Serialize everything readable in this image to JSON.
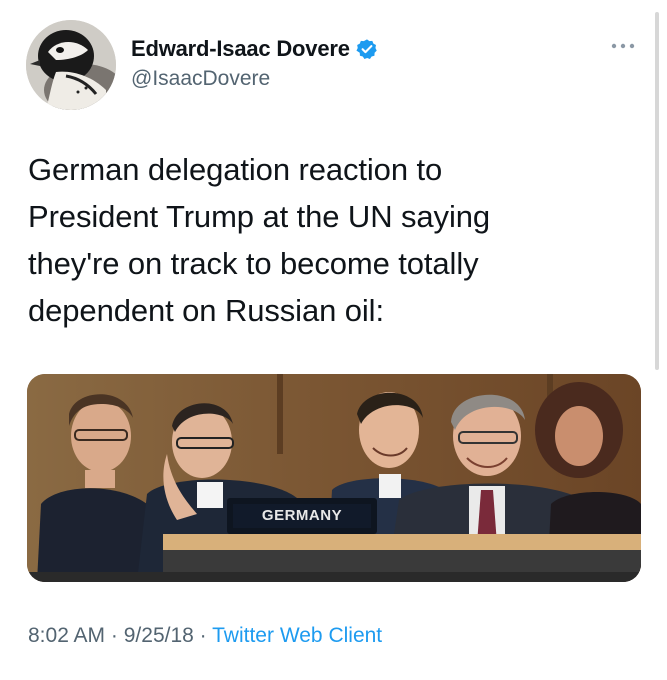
{
  "author": {
    "display_name": "Edward-Isaac Dovere",
    "handle": "@IsaacDovere",
    "verified": true
  },
  "tweet": {
    "text_lines": [
      "German delegation reaction to",
      "President Trump at the UN saying",
      "they're on track to become totally",
      "dependent on Russian oil:"
    ],
    "media": {
      "placard_text": "GERMANY"
    },
    "time": "8:02 AM",
    "date": "9/25/18",
    "separator": "·",
    "source": "Twitter Web Client"
  },
  "icons": {
    "verified": "verified-badge-icon",
    "more": "more-options-icon"
  },
  "colors": {
    "text_primary": "#0f1419",
    "text_secondary": "#536471",
    "link_blue": "#1d9bf0",
    "verified_blue": "#1d9bf0"
  }
}
